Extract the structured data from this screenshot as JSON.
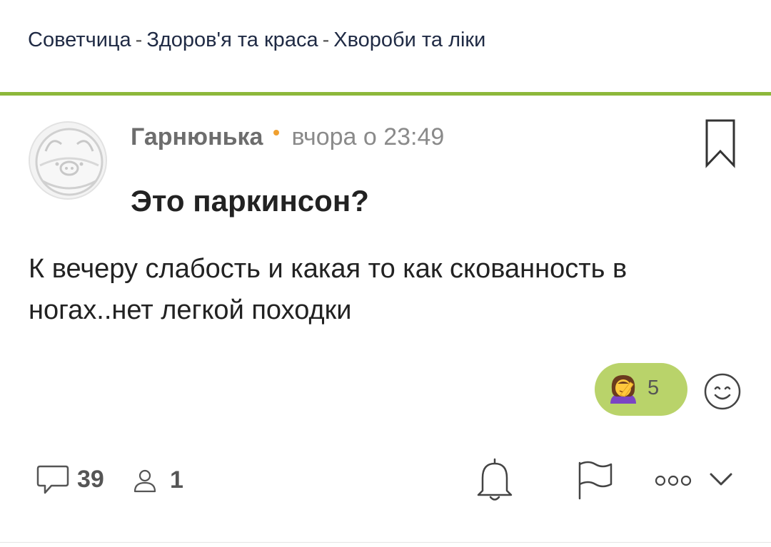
{
  "breadcrumb": {
    "items": [
      "Советчица",
      "Здоров'я та краса",
      "Хвороби та ліки"
    ],
    "separator": "-"
  },
  "post": {
    "author": "Гарнюнька",
    "time": "вчора о 23:49",
    "title": "Это паркинсон?",
    "body": "К вечеру слабость и какая то как скованность в ногах..нет легкой походки"
  },
  "reactions": {
    "emoji_icon": "facepalm-woman-emoji",
    "count": "5",
    "add_icon": "smiley-icon"
  },
  "footer": {
    "comments_count": "39",
    "participants_count": "1"
  },
  "colors": {
    "accent": "#8db83a",
    "reaction_bg": "#b9d36a",
    "author_dot": "#f0a030"
  }
}
